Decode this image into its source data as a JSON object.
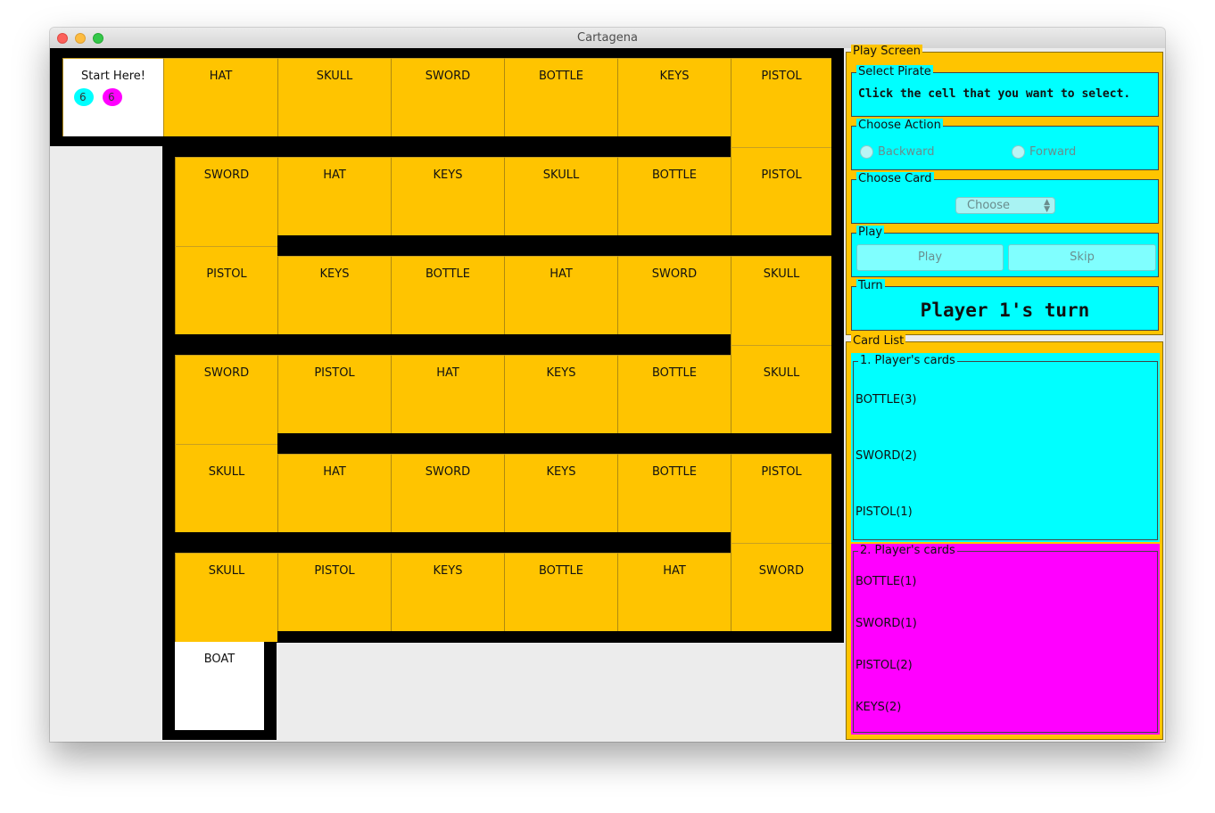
{
  "window": {
    "title": "Cartagena"
  },
  "board": {
    "start_label": "Start Here!",
    "boat_label": "BOAT",
    "tokens": [
      {
        "label": "6",
        "color": "#00ffff"
      },
      {
        "label": "6",
        "color": "#ff00ff"
      }
    ],
    "rows": [
      [
        "HAT",
        "SKULL",
        "SWORD",
        "BOTTLE",
        "KEYS",
        "PISTOL"
      ],
      [
        "SWORD",
        "HAT",
        "KEYS",
        "SKULL",
        "BOTTLE",
        "PISTOL"
      ],
      [
        "PISTOL",
        "KEYS",
        "BOTTLE",
        "HAT",
        "SWORD",
        "SKULL"
      ],
      [
        "SWORD",
        "PISTOL",
        "HAT",
        "KEYS",
        "BOTTLE",
        "SKULL"
      ],
      [
        "SKULL",
        "HAT",
        "SWORD",
        "KEYS",
        "BOTTLE",
        "PISTOL"
      ],
      [
        "SKULL",
        "PISTOL",
        "KEYS",
        "BOTTLE",
        "HAT",
        "SWORD"
      ]
    ]
  },
  "play_screen": {
    "title": "Play Screen",
    "select_pirate": {
      "title": "Select Pirate",
      "text": "Click the cell that you want to select."
    },
    "choose_action": {
      "title": "Choose Action",
      "backward": "Backward",
      "forward": "Forward"
    },
    "choose_card": {
      "title": "Choose Card",
      "selected": "Choose"
    },
    "play": {
      "title": "Play",
      "play_label": "Play",
      "skip_label": "Skip"
    },
    "turn": {
      "title": "Turn",
      "text": "Player 1's turn"
    }
  },
  "card_list": {
    "title": "Card List",
    "players": [
      {
        "title": "1. Player's cards",
        "color": "#00ffff",
        "cards": [
          "BOTTLE(3)",
          "SWORD(2)",
          "PISTOL(1)"
        ]
      },
      {
        "title": "2. Player's cards",
        "color": "#ff00ff",
        "cards": [
          "BOTTLE(1)",
          "SWORD(1)",
          "PISTOL(2)",
          "KEYS(2)"
        ]
      }
    ]
  },
  "colors": {
    "cell": "#ffc400",
    "wall": "#000000",
    "panel": "#ffc400"
  }
}
